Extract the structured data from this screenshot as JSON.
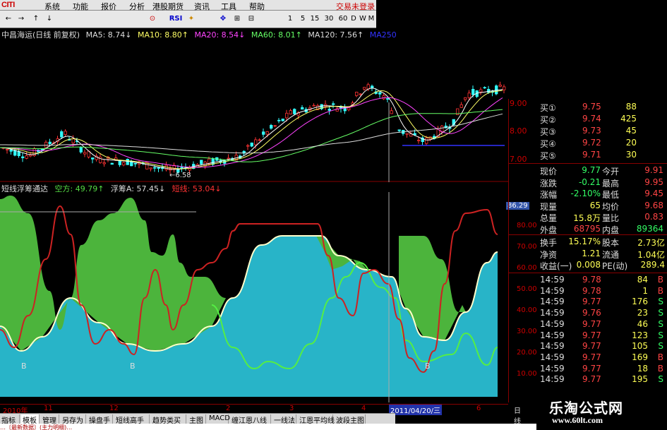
{
  "menubar": {
    "logo": "CITI",
    "items": [
      "系统",
      "功能",
      "报价",
      "分析",
      "港股期货",
      "资讯",
      "工具",
      "帮助"
    ],
    "right_text": "交易未登录"
  },
  "toolbar": {
    "buttons": [
      "←",
      "→",
      "↑",
      "↓",
      "⊙",
      "RSI",
      "✦",
      "✥",
      "⊞",
      "⊟",
      "1",
      "5",
      "15",
      "30",
      "60",
      "D",
      "W",
      "M"
    ]
  },
  "legend": {
    "stock": "中昌海运(日线 前复权)",
    "ma5": "MA5: 8.74↓",
    "ma10": "MA10: 8.80↑",
    "ma20": "MA20: 8.54↓",
    "ma60": "MA60: 8.01↑",
    "ma120": "MA120: 7.56↑",
    "ma250": "MA250"
  },
  "price_axis": [
    "9.00",
    "8.00",
    "7.00"
  ],
  "low_marker": "←6.58",
  "indicator_legend": {
    "name": "短线浮筹通达",
    "kongfang": "空方: 49.79↑",
    "fuchou": "浮筹A: 57.45↓",
    "duanxian": "短线: 53.04↓"
  },
  "ind_axis": [
    "80.00",
    "70.00",
    "60.00",
    "50.00",
    "40.00",
    "30.00",
    "20.00",
    "10.00"
  ],
  "ind_highlight": "86.29",
  "b_markers": [
    "B",
    "B",
    "B"
  ],
  "orderbook": {
    "bids": [
      {
        "label": "买①",
        "price": "9.75",
        "vol": "88"
      },
      {
        "label": "买②",
        "price": "9.74",
        "vol": "425"
      },
      {
        "label": "买③",
        "price": "9.73",
        "vol": "45"
      },
      {
        "label": "买④",
        "price": "9.72",
        "vol": "20"
      },
      {
        "label": "买⑤",
        "price": "9.71",
        "vol": "30"
      }
    ]
  },
  "quote": [
    {
      "k1": "现价",
      "v1": "9.77",
      "k2": "今开",
      "v2": "9.91"
    },
    {
      "k1": "涨跌",
      "v1": "-0.21",
      "k2": "最高",
      "v2": "9.95"
    },
    {
      "k1": "涨幅",
      "v1": "-2.10%",
      "k2": "最低",
      "v2": "9.45"
    },
    {
      "k1": "现量",
      "v1": "65",
      "k2": "均价",
      "v2": "9.68"
    },
    {
      "k1": "总量",
      "v1": "15.8万",
      "k2": "量比",
      "v2": "0.83"
    },
    {
      "k1": "外盘",
      "v1": "68795",
      "k2": "内盘",
      "v2": "89364"
    }
  ],
  "quote2": [
    {
      "k1": "换手",
      "v1": "15.17%",
      "k2": "股本",
      "v2": "2.73亿"
    },
    {
      "k1": "净资",
      "v1": "1.21",
      "k2": "流通",
      "v2": "1.04亿"
    },
    {
      "k1": "收益(一)",
      "v1": "0.008",
      "k2": "PE(动)",
      "v2": "289.4"
    }
  ],
  "ticks": [
    {
      "t": "14:59",
      "p": "9.78",
      "v": "84",
      "s": "B"
    },
    {
      "t": "14:59",
      "p": "9.78",
      "v": "1",
      "s": "B"
    },
    {
      "t": "14:59",
      "p": "9.77",
      "v": "176",
      "s": "S"
    },
    {
      "t": "14:59",
      "p": "9.76",
      "v": "23",
      "s": "S"
    },
    {
      "t": "14:59",
      "p": "9.77",
      "v": "46",
      "s": "S"
    },
    {
      "t": "14:59",
      "p": "9.77",
      "v": "123",
      "s": "S"
    },
    {
      "t": "14:59",
      "p": "9.77",
      "v": "105",
      "s": "S"
    },
    {
      "t": "14:59",
      "p": "9.77",
      "v": "169",
      "s": "B"
    },
    {
      "t": "14:59",
      "p": "9.77",
      "v": "18",
      "s": "B"
    },
    {
      "t": "14:59",
      "p": "9.77",
      "v": "195",
      "s": "S"
    }
  ],
  "datebar": {
    "labels": [
      "2010年",
      "11",
      "12",
      "2",
      "3",
      "4",
      "6"
    ],
    "cursor_date": "2011/04/20/三",
    "period": "日线"
  },
  "tabs": [
    "指标",
    "模板",
    "管理",
    "另存为",
    "操盘手",
    "短线高手",
    "趋势类买",
    "主图",
    "MACD",
    "缠江恩八线",
    "一线法",
    "江恩平均线",
    "波段主图"
  ],
  "ticker_text": "…〔最新数据〕(主力明细)…",
  "watermark": {
    "line1": "乐淘公式网",
    "line2": "www.60lt.com"
  },
  "colors": {
    "up": "#ff3333",
    "down": "#00ffff",
    "cyan_fill": "#28b4c8",
    "green_fill": "#4cb43c",
    "yellow": "#ffff00",
    "grid": "#800000"
  }
}
